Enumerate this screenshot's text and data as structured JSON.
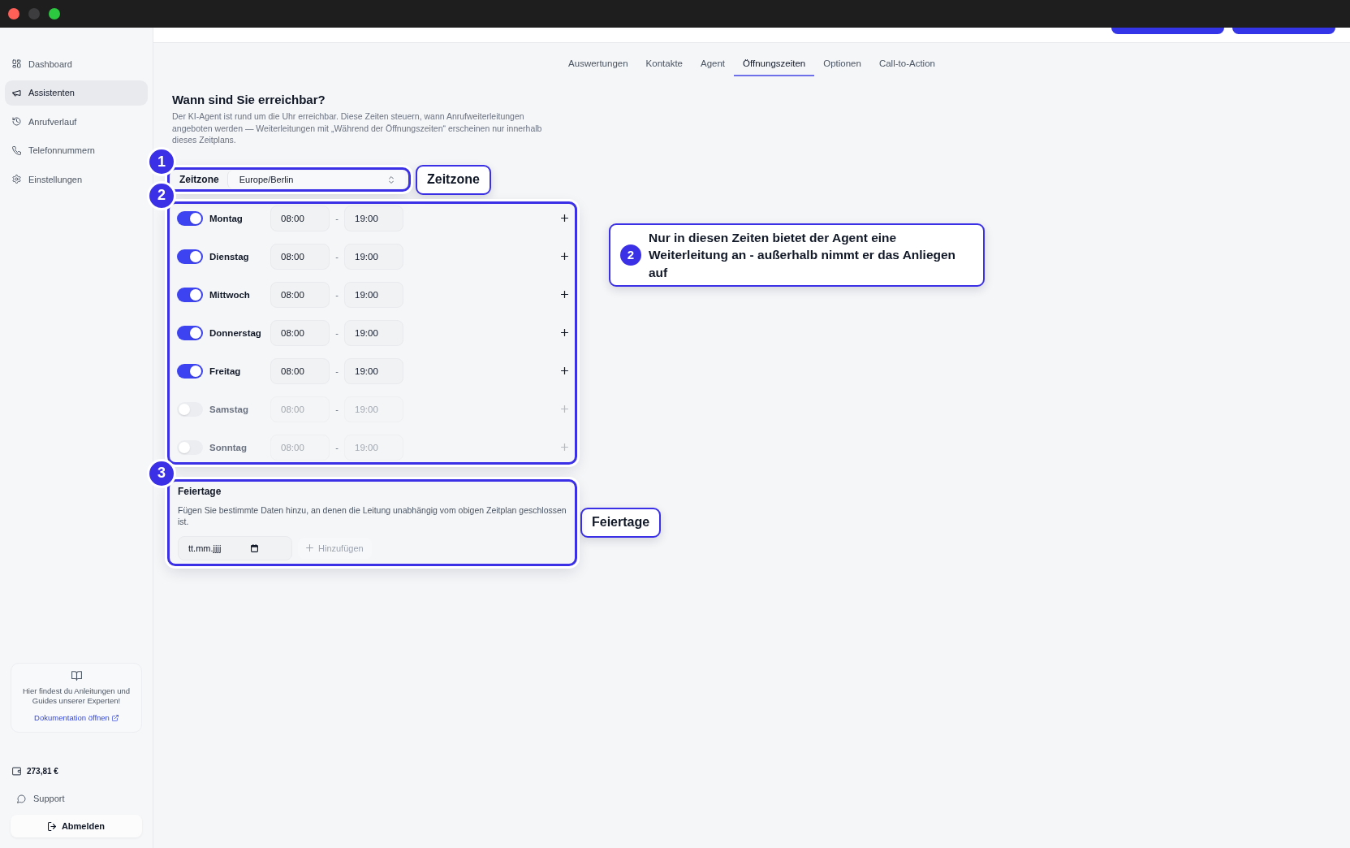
{
  "window_controls": [
    {
      "color": "#fe5f57"
    },
    {
      "color": "#3d3d3f"
    },
    {
      "color": "#2bc840"
    }
  ],
  "sidebar": {
    "nav": [
      {
        "label": "Dashboard",
        "selected": false
      },
      {
        "label": "Assistenten",
        "selected": true
      },
      {
        "label": "Anrufverlauf",
        "selected": false
      },
      {
        "label": "Telefonnummern",
        "selected": false
      },
      {
        "label": "Einstellungen",
        "selected": false
      }
    ],
    "docs_card": {
      "text": "Hier findest du Anleitungen und Guides unserer Experten!",
      "link": "Dokumentation öffnen"
    },
    "balance": "273,81 €",
    "support": "Support",
    "logout": "Abmelden"
  },
  "tabs": [
    {
      "label": "Auswertungen",
      "selected": false
    },
    {
      "label": "Kontakte",
      "selected": false
    },
    {
      "label": "Agent",
      "selected": false
    },
    {
      "label": "Öffnungszeiten",
      "selected": true
    },
    {
      "label": "Optionen",
      "selected": false
    },
    {
      "label": "Call-to-Action",
      "selected": false
    }
  ],
  "heading": "Wann sind Sie erreichbar?",
  "description": "Der KI-Agent ist rund um die Uhr erreichbar. Diese Zeiten steuern, wann Anrufweiterleitungen angeboten werden — Weiterleitungen mit „Während der Öffnungszeiten“ erscheinen nur innerhalb dieses Zeitplans.",
  "timezone": {
    "label": "Zeitzone",
    "value": "Europe/Berlin"
  },
  "schedule": [
    {
      "day": "Montag",
      "on": true,
      "from": "08:00",
      "separator": "-",
      "to": "19:00"
    },
    {
      "day": "Dienstag",
      "on": true,
      "from": "08:00",
      "separator": "-",
      "to": "19:00"
    },
    {
      "day": "Mittwoch",
      "on": true,
      "from": "08:00",
      "separator": "-",
      "to": "19:00"
    },
    {
      "day": "Donnerstag",
      "on": true,
      "from": "08:00",
      "separator": "-",
      "to": "19:00"
    },
    {
      "day": "Freitag",
      "on": true,
      "from": "08:00",
      "separator": "-",
      "to": "19:00"
    },
    {
      "day": "Samstag",
      "on": false,
      "from": "08:00",
      "separator": "-",
      "to": "19:00"
    },
    {
      "day": "Sonntag",
      "on": false,
      "from": "08:00",
      "separator": "-",
      "to": "19:00"
    }
  ],
  "holidays": {
    "heading": "Feiertage",
    "description": "Fügen Sie bestimmte Daten hinzu, an denen die Leitung unabhängig vom obigen Zeitplan geschlossen ist.",
    "date_field": {
      "placeholder": "tt.mm.jjjj"
    },
    "add_button": {
      "label": "Hinzufügen",
      "disabled": true
    }
  },
  "annotations": [
    {
      "badge": "1",
      "callout": "Zeitzone"
    },
    {
      "badge": "2",
      "callout_badge": "2",
      "callout": "Nur in diesen Zeiten bietet der Agent eine Weiterleitung an - außerhalb nimmt er das Anliegen auf"
    },
    {
      "badge": "3",
      "callout": "Feiertage"
    }
  ]
}
